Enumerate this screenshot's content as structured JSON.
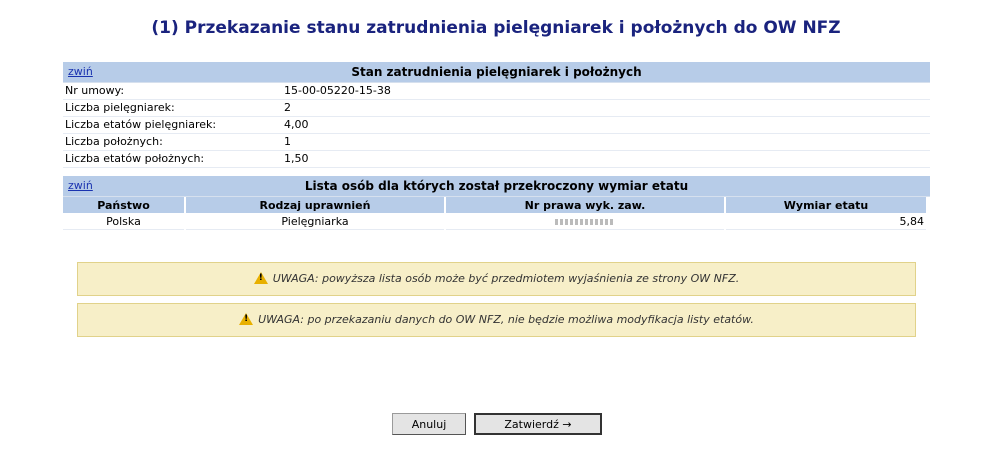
{
  "page_title": "(1) Przekazanie stanu zatrudnienia pielęgniarek i położnych do OW NFZ",
  "section1": {
    "toggle_label": "zwiń",
    "title": "Stan zatrudnienia pielęgniarek i położnych",
    "rows": [
      {
        "label": "Nr umowy:",
        "value": "15-00-05220-15-38"
      },
      {
        "label": "Liczba pielęgniarek:",
        "value": "2"
      },
      {
        "label": "Liczba etatów pielęgniarek:",
        "value": "4,00"
      },
      {
        "label": "Liczba położnych:",
        "value": "1"
      },
      {
        "label": "Liczba etatów położnych:",
        "value": "1,50"
      }
    ]
  },
  "section2": {
    "toggle_label": "zwiń",
    "title": "Lista osób dla których został przekroczony wymiar etatu",
    "columns": [
      "Państwo",
      "Rodzaj uprawnień",
      "Nr prawa wyk. zaw.",
      "Wymiar etatu"
    ],
    "rows": [
      {
        "country": "Polska",
        "type": "Pielęgniarka",
        "license": "",
        "fte": "5,84"
      }
    ]
  },
  "warnings": [
    "UWAGA: powyższa lista osób może być przedmiotem wyjaśnienia ze strony OW NFZ.",
    "UWAGA: po przekazaniu danych do OW NFZ, nie będzie możliwa modyfikacja listy etatów."
  ],
  "buttons": {
    "cancel": "Anuluj",
    "confirm": "Zatwierdź →"
  },
  "colors": {
    "title": "#1a237e",
    "section_header": "#b7cce8",
    "warning_bg": "#f7efc8",
    "link": "#1a33b0"
  }
}
